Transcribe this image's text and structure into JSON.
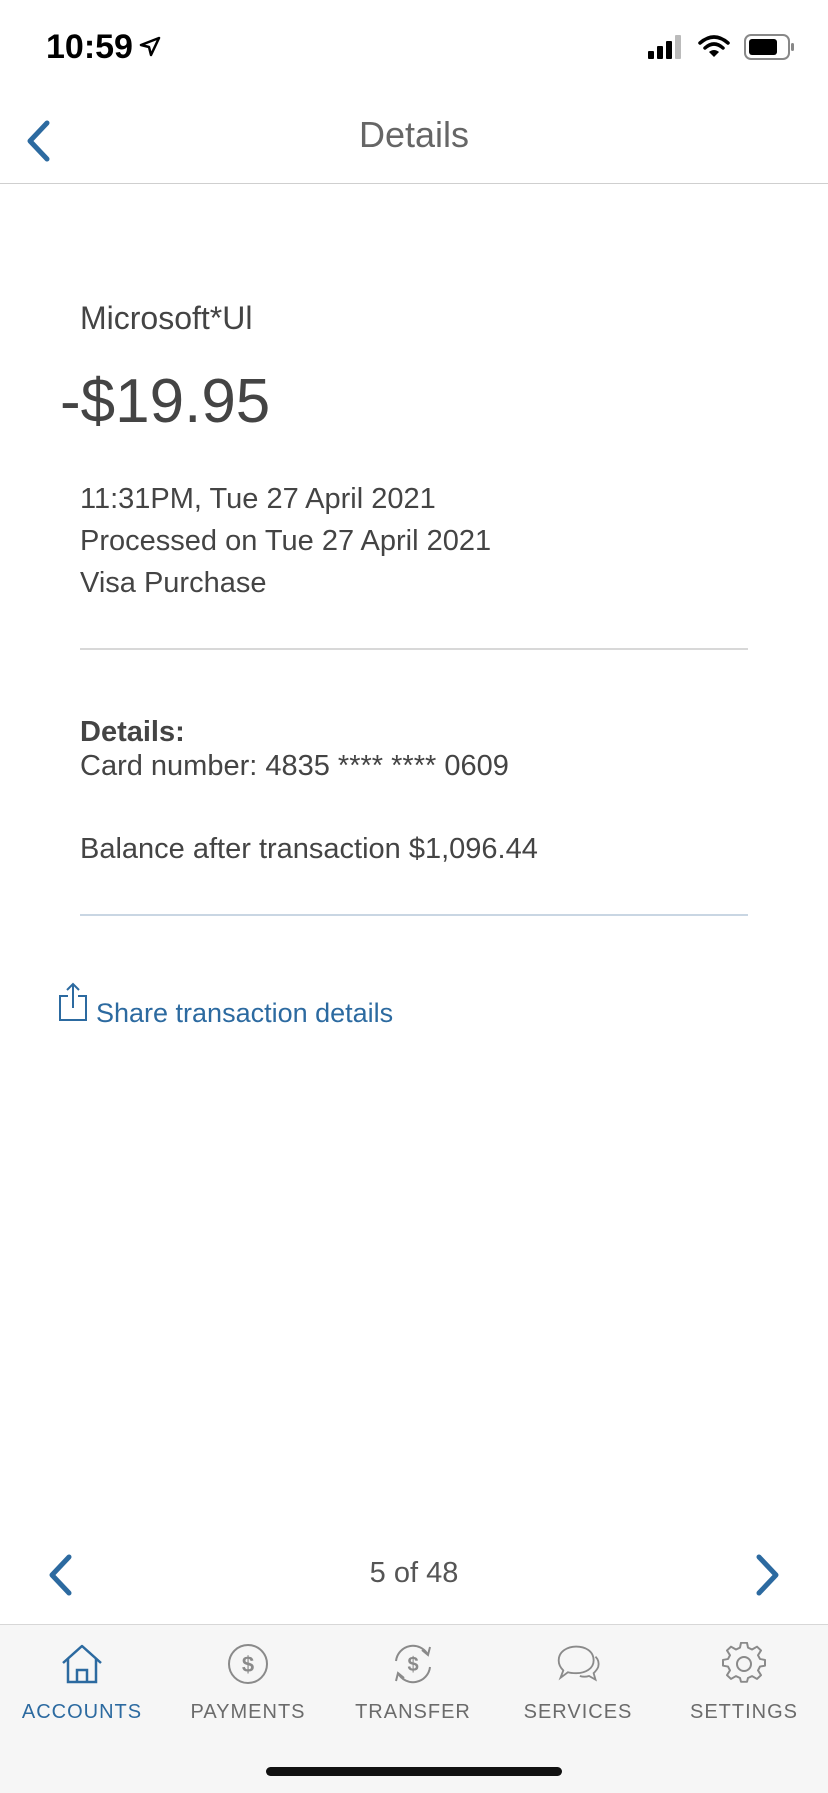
{
  "status_bar": {
    "time": "10:59"
  },
  "nav": {
    "title": "Details"
  },
  "transaction": {
    "merchant": "Microsoft*Ul",
    "amount": "-$19.95",
    "datetime": "11:31PM, Tue 27 April 2021",
    "processed": "Processed on Tue 27 April 2021",
    "type": "Visa Purchase",
    "details_label": "Details:",
    "card_number": "Card number: 4835 **** **** 0609",
    "balance": "Balance after transaction $1,096.44"
  },
  "share": {
    "label": "Share transaction details"
  },
  "pager": {
    "text": "5 of 48"
  },
  "tabs": [
    {
      "label": "ACCOUNTS",
      "icon": "home-icon",
      "active": true
    },
    {
      "label": "PAYMENTS",
      "icon": "dollar-icon",
      "active": false
    },
    {
      "label": "TRANSFER",
      "icon": "transfer-icon",
      "active": false
    },
    {
      "label": "SERVICES",
      "icon": "chat-icon",
      "active": false
    },
    {
      "label": "SETTINGS",
      "icon": "gear-icon",
      "active": false
    }
  ],
  "colors": {
    "accent": "#2c6aa0",
    "text": "#444444",
    "tabbar_bg": "#f6f6f6"
  }
}
